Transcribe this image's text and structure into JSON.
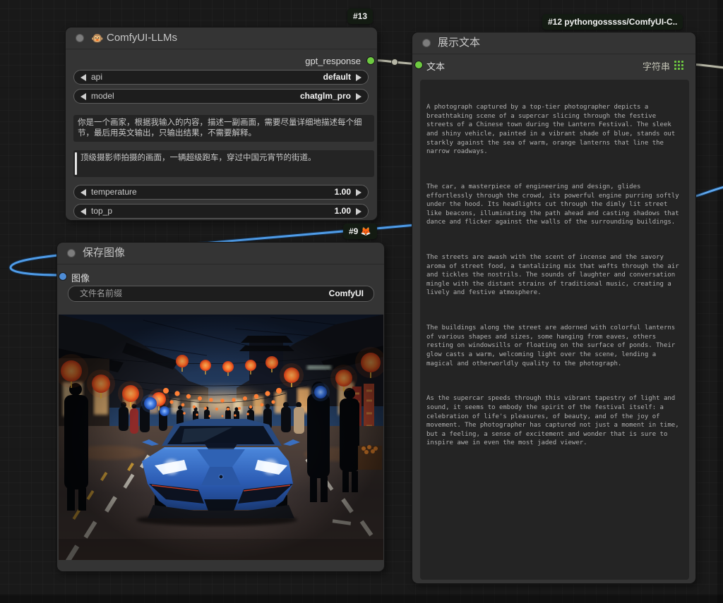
{
  "colors": {
    "link_image": "#4f9ce8",
    "link_string": "#b6b6a6",
    "slot_green": "#6ecb41",
    "slot_blue": "#4e8cd5",
    "node_bg": "#343434",
    "canvas_bg": "#191919"
  },
  "nodes": {
    "llm": {
      "badge": "#13",
      "title_icon": "🐵",
      "title": "ComfyUI-LLMs",
      "output_label": "gpt_response",
      "widgets": [
        {
          "label": "api",
          "value": "default"
        },
        {
          "label": "model",
          "value": "chatglm_pro"
        },
        {
          "label": "temperature",
          "value": "1.00"
        },
        {
          "label": "top_p",
          "value": "1.00"
        }
      ],
      "system_prompt": "你是一个画家，根据我输入的内容，描述一副画面，需要尽量详细地描述每个细节，最后用英文输出，只输出结果，不需要解释。",
      "user_prompt": "顶级摄影师拍摄的画面，一辆超级跑车，穿过中国元宵节的街道。"
    },
    "save_image": {
      "badge": "#9",
      "badge_icon": "🦊",
      "title": "保存图像",
      "input_label": "图像",
      "widget": {
        "label": "文件名前缀",
        "value": "ComfyUI"
      },
      "image_alt": "Blue supercar driving through a lantern-lit Chinese festival street at night"
    },
    "show_text": {
      "badge": "#12 pythongosssss/ComfyUI-C..",
      "title": "展示文本",
      "input_label": "文本",
      "output_label": "字符串",
      "paragraphs": [
        "A photograph captured by a top-tier photographer depicts a breathtaking scene of a supercar slicing through the festive streets of a Chinese town during the Lantern Festival. The sleek and shiny vehicle, painted in a vibrant shade of blue, stands out starkly against the sea of warm, orange lanterns that line the narrow roadways.",
        "The car, a masterpiece of engineering and design, glides effortlessly through the crowd, its powerful engine purring softly under the hood. Its headlights cut through the dimly lit street like beacons, illuminating the path ahead and casting shadows that dance and flicker against the walls of the surrounding buildings.",
        "The streets are awash with the scent of incense and the savory aroma of street food, a tantalizing mix that wafts through the air and tickles the nostrils. The sounds of laughter and conversation mingle with the distant strains of traditional music, creating a lively and festive atmosphere.",
        "The buildings along the street are adorned with colorful lanterns of various shapes and sizes, some hanging from eaves, others resting on windowsills or floating on the surface of ponds. Their glow casts a warm, welcoming light over the scene, lending a magical and otherworldly quality to the photograph.",
        "As the supercar speeds through this vibrant tapestry of light and sound, it seems to embody the spirit of the festival itself: a celebration of life's pleasures, of beauty, and of the joy of movement. The photographer has captured not just a moment in time, but a feeling, a sense of excitement and wonder that is sure to inspire awe in even the most jaded viewer."
      ]
    }
  }
}
